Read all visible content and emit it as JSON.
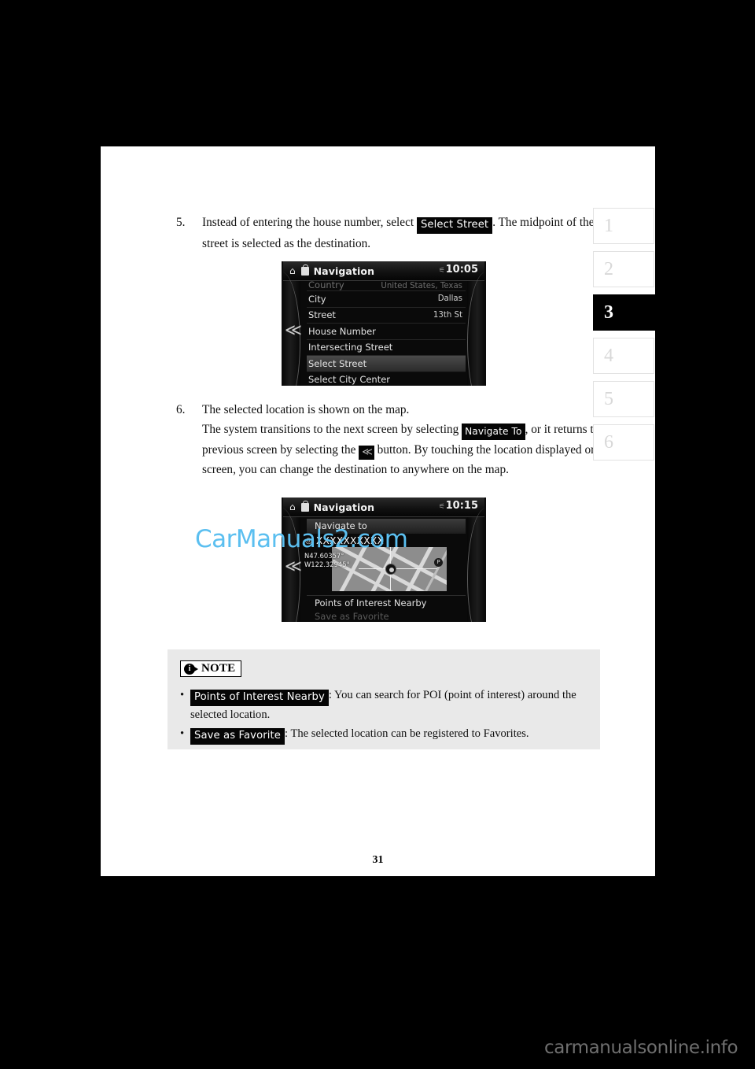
{
  "page": {
    "number": "31"
  },
  "tabs": [
    {
      "label": "1",
      "active": false
    },
    {
      "label": "2",
      "active": false
    },
    {
      "label": "3",
      "active": true
    },
    {
      "label": "4",
      "active": false
    },
    {
      "label": "5",
      "active": false
    },
    {
      "label": "6",
      "active": false
    }
  ],
  "steps": {
    "five": {
      "number": "5.",
      "text_before": "Instead of entering the house number, select",
      "chip": "Select Street",
      "text_after": ". The midpoint of the street is selected as the destination."
    },
    "six": {
      "number": "6.",
      "line1": "The selected location is shown on the map.",
      "line2_before": "The system transitions to the next screen by selecting",
      "chip_navigate": "Navigate To",
      "line2_after": ", or it returns to the previous screen by selecting the",
      "chip_back": "≪",
      "line3_after": "button. By touching the location displayed on the screen, you can change the destination to anywhere on the map."
    }
  },
  "device1": {
    "home_icon": "home-icon",
    "app_icon": "navigation-bag-icon",
    "title": "Navigation",
    "bluetooth_icon": "bluetooth-icon",
    "clock": "10:05",
    "back_icon": "≪",
    "rows": [
      {
        "label": "Country",
        "value": "United States, Texas",
        "state": "clipped"
      },
      {
        "label": "City",
        "value": "Dallas",
        "state": "normal"
      },
      {
        "label": "Street",
        "value": "13th St",
        "state": "normal"
      },
      {
        "label": "House Number",
        "value": "",
        "state": "normal"
      },
      {
        "label": "Intersecting Street",
        "value": "",
        "state": "normal"
      },
      {
        "label": "Select Street",
        "value": "",
        "state": "selected"
      },
      {
        "label": "Select City Center",
        "value": "",
        "state": "normal"
      }
    ]
  },
  "device2": {
    "home_icon": "home-icon",
    "app_icon": "navigation-bag-icon",
    "title": "Navigation",
    "bluetooth_icon": "bluetooth-icon",
    "clock": "10:15",
    "back_icon": "≪",
    "navigate_to": "Navigate to",
    "destination": "XXXXXXXXXX",
    "destination_icon": "location-pin-icon",
    "latitude": "N47.60357°",
    "longitude": "W122.32945°",
    "poi_badge": "P",
    "points_of_interest": "Points of Interest Nearby",
    "save_as_favorite": "Save as Favorite"
  },
  "note": {
    "label": "NOTE",
    "mark": "i",
    "items": [
      {
        "bullet": "•",
        "chip": "Points of Interest Nearby",
        "text": ": You can search for POI (point of interest) around the selected location."
      },
      {
        "bullet": "•",
        "chip": "Save as Favorite",
        "text": ": The selected location can be registered to Favorites."
      }
    ]
  },
  "watermarks": {
    "center": "CarManuals2.com",
    "bottom": "carmanualsonline.info",
    "center_color": "#5bbff0",
    "bottom_color": "#6f6f6f"
  }
}
